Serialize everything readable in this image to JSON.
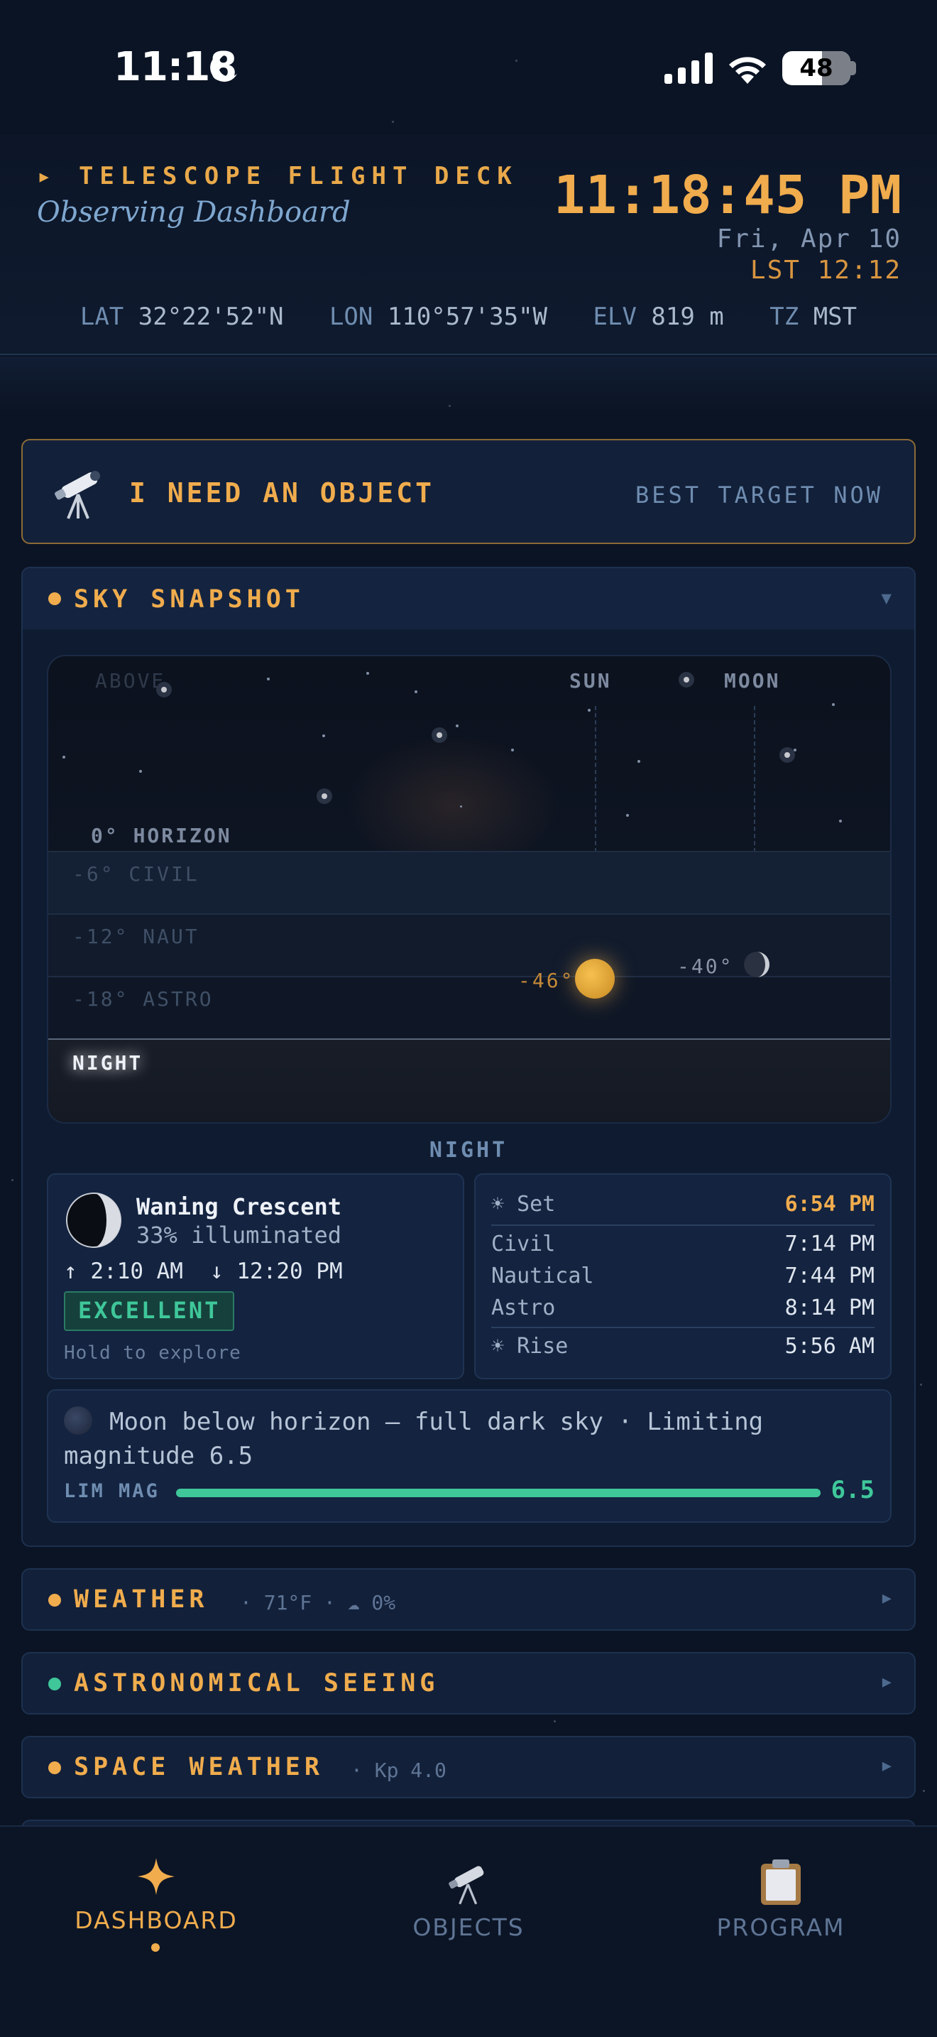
{
  "status_bar": {
    "time": "11:18",
    "battery": "48"
  },
  "header": {
    "kicker": "▸ TELESCOPE FLIGHT DECK",
    "subtitle": "Observing Dashboard",
    "clock": "11:18:45 PM",
    "date": "Fri, Apr 10",
    "lst": "LST 12:12",
    "coords": [
      {
        "key": "LAT",
        "value": "32°22'52\"N"
      },
      {
        "key": "LON",
        "value": "110°57'35\"W"
      },
      {
        "key": "ELV",
        "value": "819 m"
      },
      {
        "key": "TZ",
        "value": "MST"
      }
    ]
  },
  "cta": {
    "label": "I NEED AN OBJECT",
    "hint": "BEST TARGET NOW"
  },
  "sky_snapshot": {
    "title": "SKY SNAPSHOT",
    "chart": {
      "above_label": "ABOVE",
      "sun_label": "SUN",
      "moon_label": "MOON",
      "bands": [
        "0° HORIZON",
        "-6° CIVIL",
        "-12° NAUT",
        "-18° ASTRO",
        "NIGHT"
      ],
      "sun_altitude": "-46°",
      "moon_altitude": "-40°"
    },
    "phase_caption": "NIGHT",
    "moon": {
      "phase": "Waning Crescent",
      "illumination": "33% illuminated",
      "rise": "↑ 2:10 AM",
      "set": "↓ 12:20 PM",
      "rating": "EXCELLENT",
      "hint": "Hold to explore"
    },
    "sun_times": {
      "set_label": "☀ Set",
      "set_value": "6:54 PM",
      "rows": [
        {
          "label": "Civil",
          "value": "7:14 PM"
        },
        {
          "label": "Nautical",
          "value": "7:44 PM"
        },
        {
          "label": "Astro",
          "value": "8:14 PM"
        }
      ],
      "rise_label": "☀ Rise",
      "rise_value": "5:56 AM"
    },
    "dark_sky": {
      "message": "Moon below horizon — full dark sky · Limiting magnitude 6.5",
      "lim_label": "LIM MAG",
      "lim_value": "6.5",
      "lim_fraction": 1.0
    }
  },
  "sections": [
    {
      "title": "WEATHER",
      "summary": "· 71°F · ☁ 0%",
      "dot": "#f0ac4d"
    },
    {
      "title": "ASTRONOMICAL SEEING",
      "summary": "",
      "dot": "#3fc79a"
    },
    {
      "title": "SPACE WEATHER",
      "summary": "· Kp 4.0",
      "dot": "#f0ac4d"
    }
  ],
  "tabs": [
    {
      "label": "DASHBOARD",
      "active": true
    },
    {
      "label": "OBJECTS",
      "active": false
    },
    {
      "label": "PROGRAM",
      "active": false
    }
  ],
  "colors": {
    "accent": "#f0ac4d",
    "success": "#3fc79a",
    "background": "#0b1424"
  }
}
